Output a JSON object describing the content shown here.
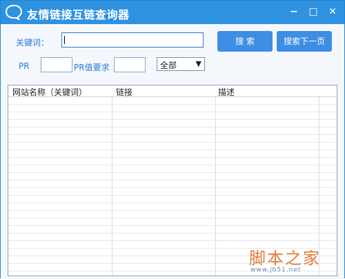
{
  "window": {
    "title": "友情链接互链查询器",
    "min_glyph": "−",
    "max_glyph": "□",
    "close_glyph": "✕"
  },
  "form": {
    "keyword_label": "关键词：",
    "keyword_value": "",
    "search_button": "搜  索",
    "search_next_button": "搜索下一页",
    "pr_label": "PR",
    "pr_value": "",
    "pr_required_label": "PR值要求",
    "pr_required_value": "",
    "filter_selected": "全部"
  },
  "table": {
    "headers": [
      "网站名称（关键词）",
      "链接",
      "描述"
    ],
    "rows": []
  },
  "watermark": {
    "main": "脚本之家",
    "sub": "www.jb51.net"
  },
  "colors": {
    "titlebar": "#2f92e0",
    "accent": "#3e8ee3",
    "label_blue": "#2a78d4"
  },
  "icons": {
    "app": "speech-bubble-icon",
    "minimize": "minimize-icon",
    "maximize": "maximize-icon",
    "close": "close-icon"
  }
}
